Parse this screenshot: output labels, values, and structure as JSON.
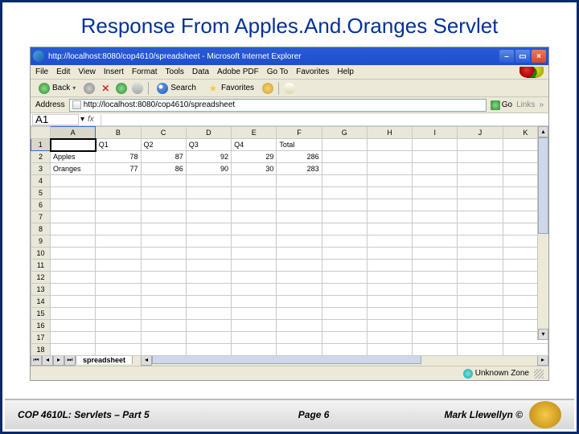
{
  "title": "Response From Apples.And.Oranges Servlet",
  "window_title": "http://localhost:8080/cop4610/spreadsheet - Microsoft Internet Explorer",
  "menubar": [
    "File",
    "Edit",
    "View",
    "Insert",
    "Format",
    "Tools",
    "Data",
    "Adobe PDF",
    "Go To",
    "Favorites",
    "Help"
  ],
  "toolbar": {
    "back": "Back",
    "search": "Search",
    "favorites": "Favorites"
  },
  "addrbar": {
    "label": "Address",
    "url": "http://localhost:8080/cop4610/spreadsheet",
    "go": "Go",
    "links": "Links"
  },
  "formula": {
    "name": "A1",
    "fx": "fx"
  },
  "cols": [
    "A",
    "B",
    "C",
    "D",
    "E",
    "F",
    "G",
    "H",
    "I",
    "J",
    "K"
  ],
  "rows": [
    "1",
    "2",
    "3",
    "4",
    "5",
    "6",
    "7",
    "8",
    "9",
    "10",
    "11",
    "12",
    "13",
    "14",
    "15",
    "16",
    "17",
    "18"
  ],
  "chart_data": {
    "type": "table",
    "title": "",
    "headers": [
      "",
      "Q1",
      "Q2",
      "Q3",
      "Q4",
      "Total"
    ],
    "rows": [
      {
        "label": "Apples",
        "values": [
          78,
          87,
          92,
          29,
          286
        ]
      },
      {
        "label": "Oranges",
        "values": [
          77,
          86,
          90,
          30,
          283
        ]
      }
    ]
  },
  "tab": "spreadsheet",
  "status": "Unknown Zone",
  "footer": {
    "left": "COP 4610L: Servlets – Part 5",
    "mid": "Page 6",
    "right": "Mark Llewellyn ©"
  }
}
